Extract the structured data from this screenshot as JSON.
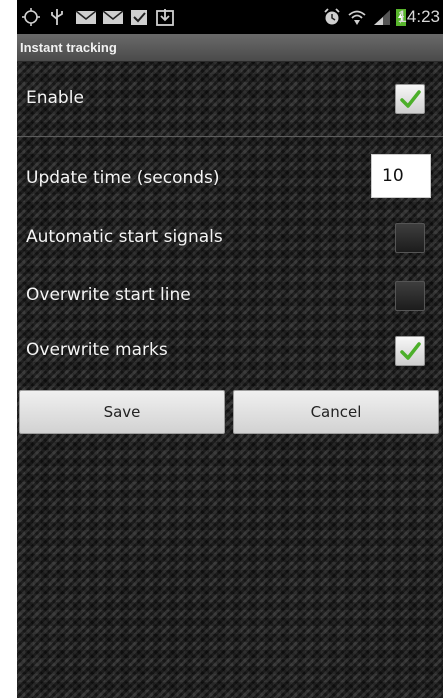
{
  "status_bar": {
    "time": "14:23",
    "icons": [
      "location-icon",
      "usb-icon",
      "missed-email-icon",
      "missed-email-icon",
      "task-done-icon",
      "download-icon",
      "alarm-icon",
      "wifi-icon",
      "signal-icon",
      "battery-charging-icon"
    ]
  },
  "title": "Instant tracking",
  "settings": {
    "enable": {
      "label": "Enable",
      "checked": true
    },
    "update_time": {
      "label": "Update time (seconds)",
      "value": "10"
    },
    "auto_start": {
      "label": "Automatic start signals",
      "checked": false
    },
    "overwrite_start_line": {
      "label": "Overwrite start line",
      "checked": false
    },
    "overwrite_marks": {
      "label": "Overwrite marks",
      "checked": true
    }
  },
  "buttons": {
    "save": "Save",
    "cancel": "Cancel"
  },
  "colors": {
    "check_green": "#4caf2a",
    "title_bar": "#5a5a5a"
  }
}
